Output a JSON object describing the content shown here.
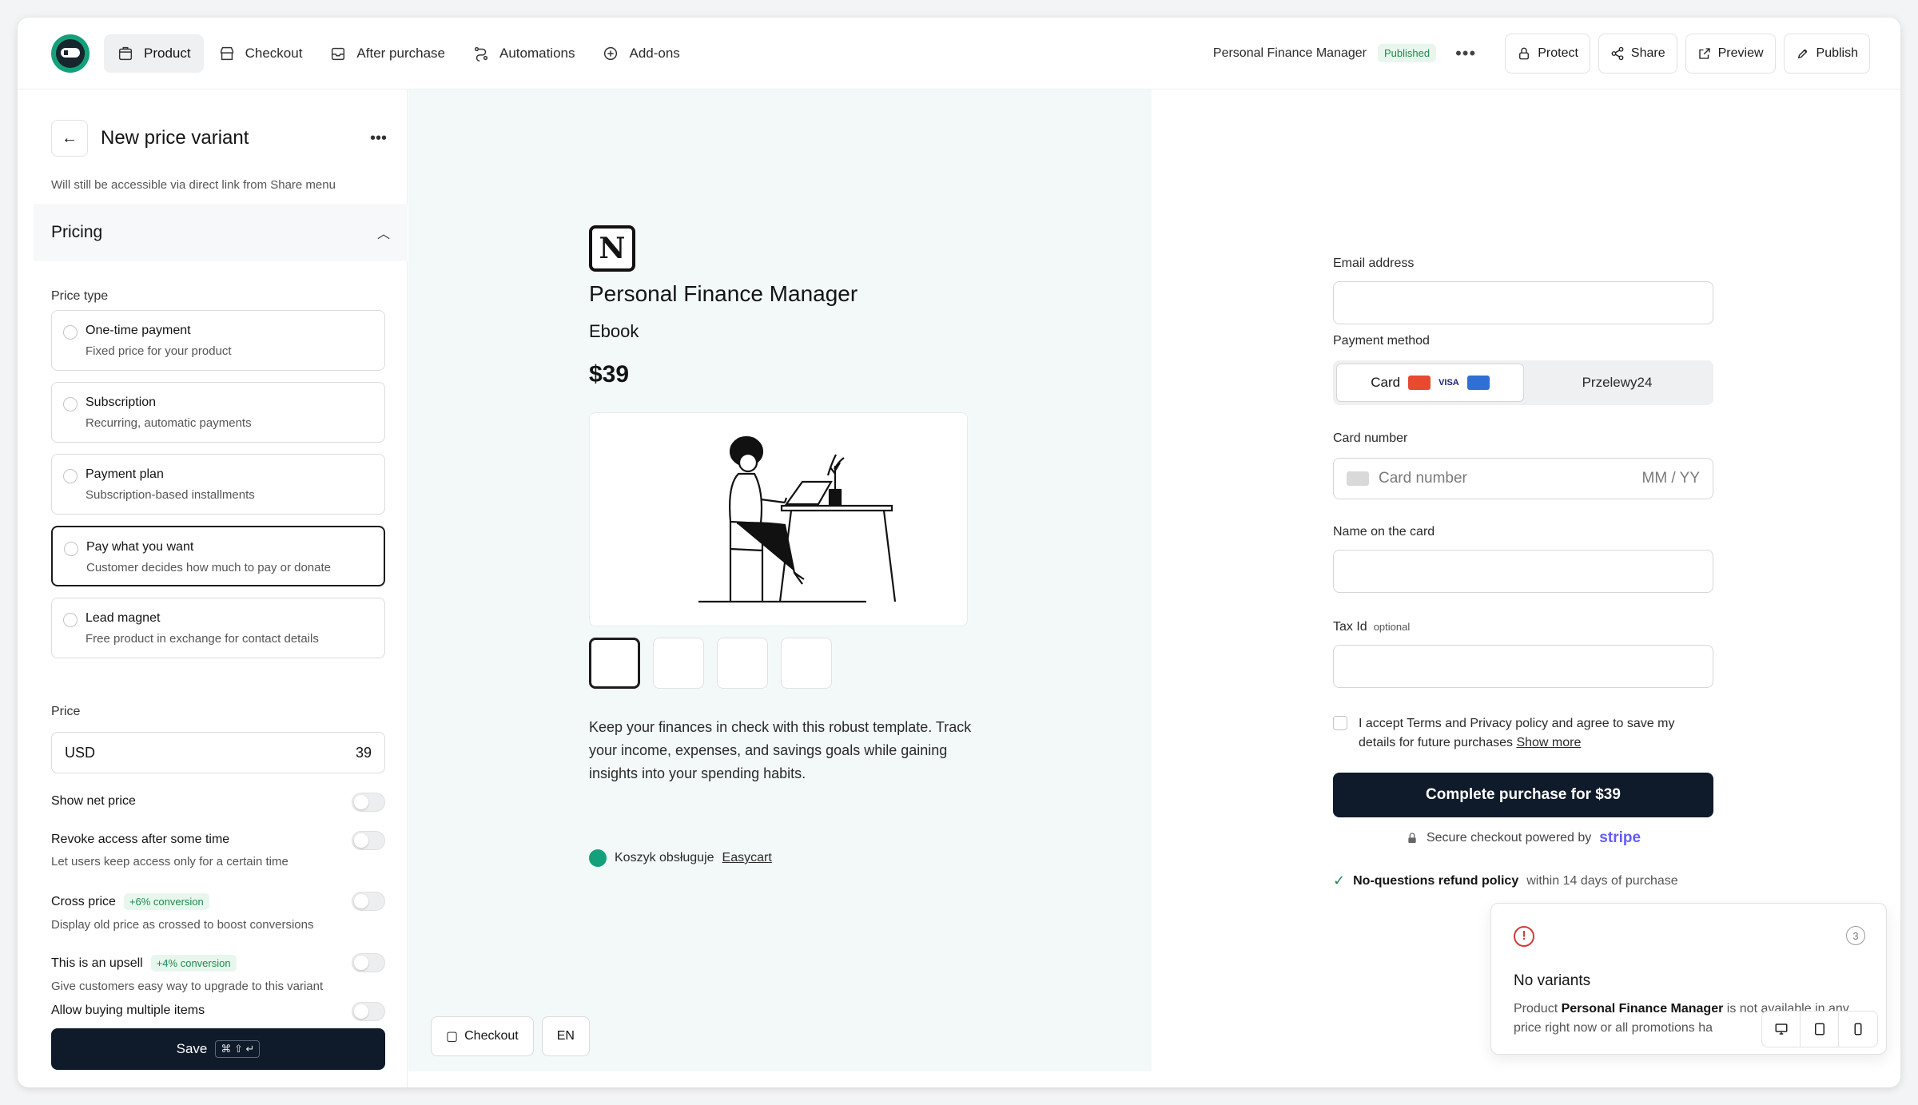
{
  "nav": {
    "tabs": [
      {
        "label": "Product",
        "icon": "box-icon"
      },
      {
        "label": "Checkout",
        "icon": "store-icon"
      },
      {
        "label": "After purchase",
        "icon": "inbox-icon"
      },
      {
        "label": "Automations",
        "icon": "workflow-icon"
      },
      {
        "label": "Add-ons",
        "icon": "addon-icon"
      }
    ],
    "product_name": "Personal Finance Manager",
    "status": "Published",
    "buttons": {
      "protect": "Protect",
      "share": "Share",
      "preview": "Preview",
      "publish": "Publish"
    }
  },
  "editor": {
    "title": "New price variant",
    "visibility_note": "Will still be accessible via direct link from Share menu",
    "section": "Pricing",
    "price_type_label": "Price type",
    "price_types": [
      {
        "title": "One-time payment",
        "desc": "Fixed price for your product"
      },
      {
        "title": "Subscription",
        "desc": "Recurring, automatic payments"
      },
      {
        "title": "Payment plan",
        "desc": "Subscription-based installments"
      },
      {
        "title": "Pay what you want",
        "desc": "Customer decides how much to pay or donate"
      },
      {
        "title": "Lead magnet",
        "desc": "Free product in exchange for contact details"
      }
    ],
    "price_label": "Price",
    "currency": "USD",
    "price_value": "39",
    "toggles": {
      "net_price": "Show net price",
      "revoke_title": "Revoke access after some time",
      "revoke_desc": "Let users keep access only for a certain time",
      "cross_title": "Cross price",
      "cross_badge": "+6% conversion",
      "cross_desc": "Display old price as crossed to boost conversions",
      "upsell_title": "This is an upsell",
      "upsell_badge": "+4% conversion",
      "upsell_desc": "Give customers easy way to upgrade to this variant",
      "multiple": "Allow buying multiple items"
    },
    "save_label": "Save",
    "save_shortcut": "⌘ ⇧ ↵"
  },
  "preview": {
    "logo_letter": "N",
    "title": "Personal Finance Manager",
    "subtitle": "Ebook",
    "price": "$39",
    "description": "Keep your finances in check with this robust template. Track your income, expenses, and savings goals while gaining insights into your spending habits.",
    "powered_prefix": "Koszyk obsługuje",
    "powered_link": "Easycart",
    "chip_checkout": "Checkout",
    "chip_lang": "EN"
  },
  "checkout": {
    "email_label": "Email address",
    "payment_label": "Payment method",
    "card_tab": "Card",
    "alt_tab": "Przelewy24",
    "card_number_label": "Card number",
    "card_number_placeholder": "Card number",
    "expiry_placeholder": "MM / YY",
    "name_label": "Name on the card",
    "tax_label": "Tax Id",
    "tax_optional": "optional",
    "accept_text": "I accept Terms and Privacy policy and agree to save my details for future purchases",
    "show_more": "Show more",
    "buy_button": "Complete purchase for $39",
    "secure_text": "Secure checkout powered by",
    "secure_brand": "stripe",
    "refund_bold": "No-questions refund policy",
    "refund_rest": "within 14 days of purchase",
    "colors": {
      "primary": "#0f1a2a",
      "accent_green": "#14a07a"
    }
  },
  "toast": {
    "count": "3",
    "title": "No variants",
    "body_prefix": "Product",
    "body_product": "Personal Finance Manager",
    "body_suffix": "is not available in any price right now or all promotions ha"
  }
}
